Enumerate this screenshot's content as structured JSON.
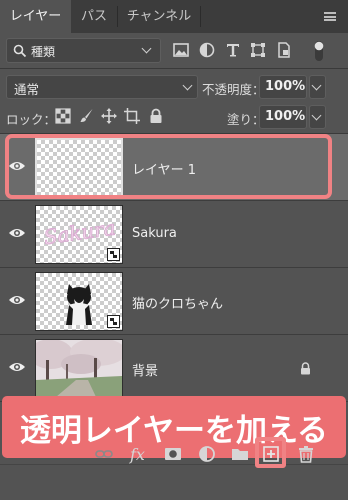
{
  "tabs": [
    {
      "label": "レイヤー",
      "active": true
    },
    {
      "label": "パス",
      "active": false
    },
    {
      "label": "チャンネル",
      "active": false
    }
  ],
  "filter": {
    "kind_label": "種類"
  },
  "blend": {
    "mode": "通常",
    "opacity_label": "不透明度：",
    "opacity_value": "100%"
  },
  "lock": {
    "label": "ロック：",
    "fill_label": "塗り：",
    "fill_value": "100%"
  },
  "layers": [
    {
      "name": "レイヤー 1",
      "selected": true,
      "visible": true,
      "thumb": "transparent"
    },
    {
      "name": "Sakura",
      "selected": false,
      "visible": true,
      "thumb": "sakura-text-smart-object"
    },
    {
      "name": "猫のクロちゃん",
      "selected": false,
      "visible": true,
      "thumb": "cat-smart-object"
    },
    {
      "name": "背景",
      "selected": false,
      "visible": true,
      "thumb": "cherry-blossom-photo",
      "locked": true
    }
  ],
  "caption": "透明レイヤーを加える",
  "toolbar_icons": [
    "link-icon",
    "fx-icon",
    "mask-icon",
    "adjustment-icon",
    "folder-icon",
    "new-layer-icon",
    "trash-icon"
  ],
  "fx_label": "fx",
  "sakura_thumb_text": "Sakura",
  "colors": {
    "highlight": "#f08284",
    "caption_bg": "#ec6f72",
    "panel_bg": "#535353",
    "selected_row": "#6b6b6b"
  }
}
